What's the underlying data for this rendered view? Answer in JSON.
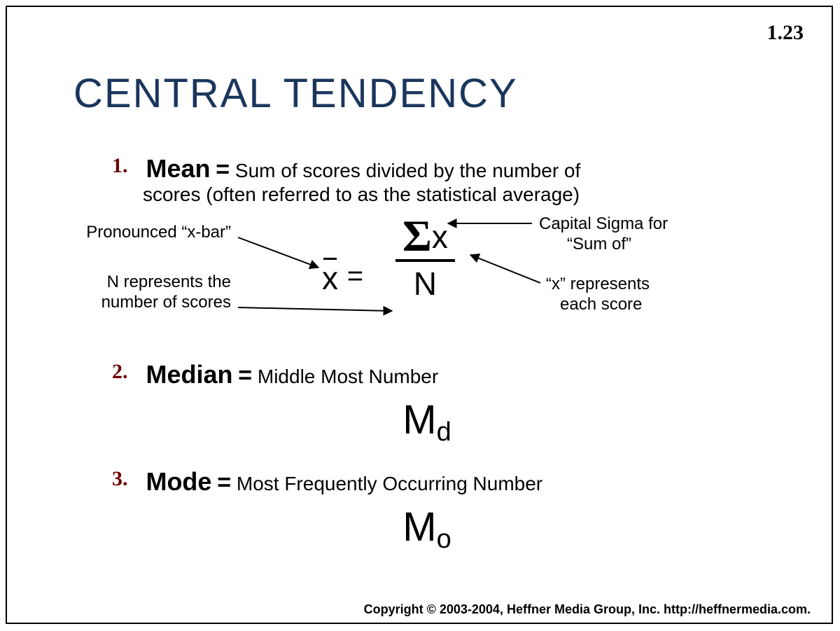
{
  "slide_number": "1.23",
  "title": "CENTRAL TENDENCY",
  "items": [
    {
      "num": "1.",
      "term": "Mean",
      "eq": "=",
      "desc_line1": "Sum of scores divided by the number of",
      "desc_line2": "scores (often referred to as the statistical average)"
    },
    {
      "num": "2.",
      "term": "Median",
      "eq": "=",
      "desc": "Middle Most Number",
      "symbol_main": "M",
      "symbol_sub": "d"
    },
    {
      "num": "3.",
      "term": "Mode",
      "eq": "=",
      "desc": "Most Frequently Occurring Number",
      "symbol_main": "M",
      "symbol_sub": "o"
    }
  ],
  "formula": {
    "xbar": "x",
    "equals": "=",
    "sigma": "Σ",
    "x": "x",
    "N": "N"
  },
  "annotations": {
    "xbar": "Pronounced “x-bar”",
    "N_l1": "N represents the",
    "N_l2": "number of scores",
    "sigma_l1": "Capital Sigma for",
    "sigma_l2": "“Sum of”",
    "x_l1": "“x” represents",
    "x_l2": "each score"
  },
  "copyright": "Copyright © 2003-2004, Heffner Media Group, Inc.  http://heffnermedia.com."
}
